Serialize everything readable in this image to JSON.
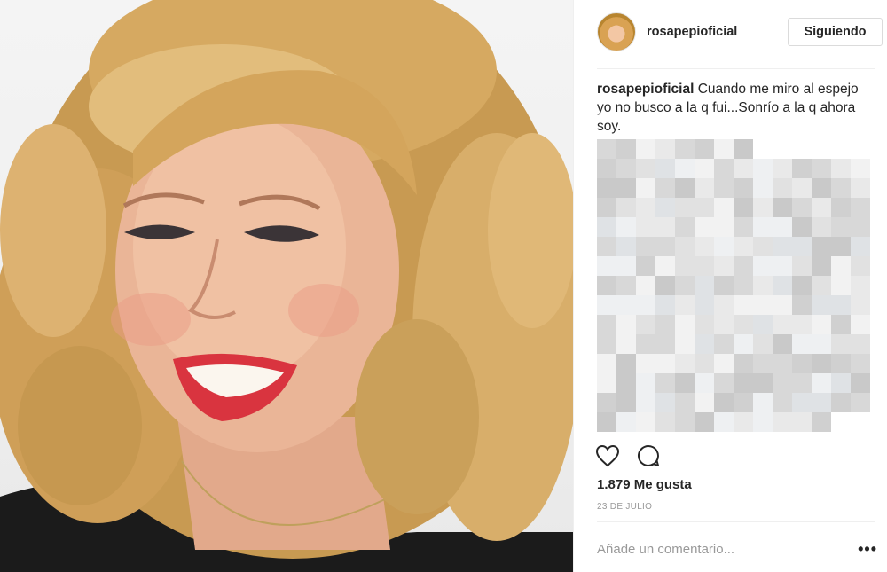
{
  "post": {
    "author": {
      "username": "rosapepioficial",
      "follow_label": "Siguiendo"
    },
    "caption": {
      "username": "rosapepioficial",
      "text": "Cuando me miro al espejo yo no busco a la q fui...Sonrío a la q ahora soy."
    },
    "likes_label": "1.879 Me gusta",
    "date_label": "23 DE JULIO",
    "comment": {
      "placeholder": "Añade un comentario..."
    },
    "more_label": "•••",
    "icons": {
      "like": "heart-icon",
      "comment": "comment-icon",
      "more": "more-icon"
    },
    "colors": {
      "text": "#262626",
      "muted": "#999999",
      "border": "#dbdbdb"
    }
  }
}
